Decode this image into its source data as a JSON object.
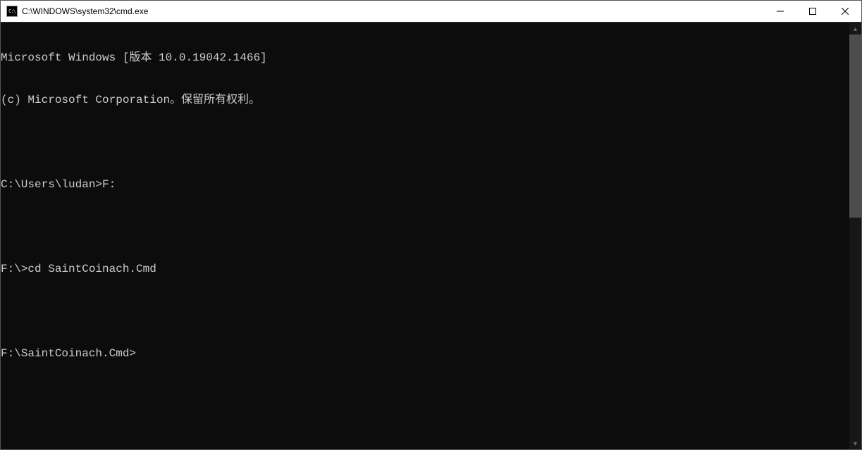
{
  "window": {
    "title": "C:\\WINDOWS\\system32\\cmd.exe",
    "icon_label": "C:\\"
  },
  "terminal": {
    "lines": [
      "Microsoft Windows [版本 10.0.19042.1466]",
      "(c) Microsoft Corporation。保留所有权利。",
      "",
      "C:\\Users\\ludan>F:",
      "",
      "F:\\>cd SaintCoinach.Cmd",
      "",
      "F:\\SaintCoinach.Cmd>"
    ]
  },
  "scrollbar": {
    "up_glyph": "▲",
    "down_glyph": "▼"
  }
}
